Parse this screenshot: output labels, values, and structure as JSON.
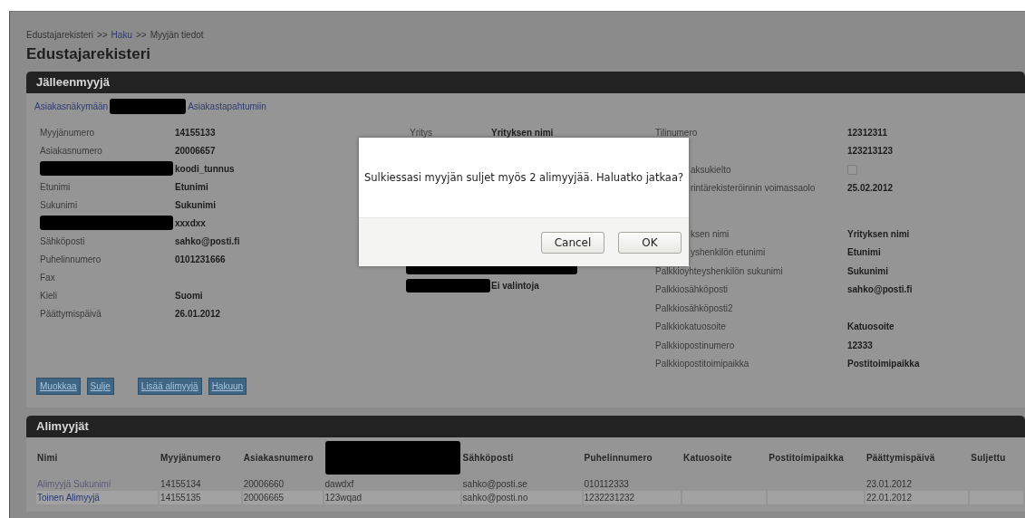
{
  "breadcrumb": [
    {
      "label": "Edustajarekisteri",
      "link": false
    },
    {
      "label": "Haku",
      "link": true
    },
    {
      "label": "Myyjän tiedot",
      "link": false
    }
  ],
  "breadcrumb_separator": ">>",
  "title": "Edustajarekisteri",
  "reseller": {
    "heading": "Jälleenmyyjä",
    "links": [
      {
        "kind": "link",
        "label": "Asiakasnäkymään"
      },
      {
        "kind": "redacted"
      },
      {
        "kind": "link",
        "label": "Asiakastapahtumiin"
      }
    ],
    "columns": [
      {
        "groups": [
          [
            {
              "kind": "field",
              "label": "Myyjänumero",
              "value": "14155133"
            },
            {
              "kind": "field",
              "label": "Asiakasnumero",
              "value": "20006657"
            },
            {
              "kind": "redacted",
              "value": "koodi_tunnus"
            },
            {
              "kind": "field",
              "label": "Etunimi",
              "value": "Etunimi"
            },
            {
              "kind": "field",
              "label": "Sukunimi",
              "value": "Sukunimi"
            },
            {
              "kind": "redacted",
              "value": "xxxdxx"
            },
            {
              "kind": "field",
              "label": "Sähköposti",
              "value": "sahko@posti.fi"
            },
            {
              "kind": "field",
              "label": "Puhelinnumero",
              "value": "0101231666"
            },
            {
              "kind": "field",
              "label": "Fax"
            },
            {
              "kind": "field",
              "label": "Kieli",
              "value": "Suomi"
            },
            {
              "kind": "field",
              "label": "Päättymispäivä",
              "value": "26.01.2012"
            }
          ]
        ]
      },
      {
        "groups": [
          [
            {
              "kind": "field",
              "label": "Yritys",
              "value": "Yrityksen nimi"
            }
          ],
          [
            {
              "kind": "blackout"
            },
            {
              "kind": "redacted",
              "value": "Ei valintoja"
            }
          ]
        ]
      },
      {
        "groups": [
          [
            {
              "kind": "field",
              "label": "Tilinumero",
              "value": "12312311"
            },
            {
              "kind": "value_only",
              "value": "123213123"
            },
            {
              "kind": "checkbox",
              "label": "aksukielto",
              "cut": true,
              "checked": false
            },
            {
              "kind": "field",
              "label": "rintärekisteröinnin voimassaolo",
              "cut": true,
              "value": "25.02.2012"
            }
          ],
          [
            {
              "kind": "field",
              "label": "ksen nimi",
              "cut": true,
              "value": "Yrityksen nimi"
            },
            {
              "kind": "field",
              "label": "yshenkilön etunimi",
              "cut": true,
              "value": "Etunimi"
            },
            {
              "kind": "field",
              "label": "Palkkioyhteyshenkilön sukunimi",
              "value": "Sukunimi"
            },
            {
              "kind": "field",
              "label": "Palkkiosähköposti",
              "value": "sahko@posti.fi"
            },
            {
              "kind": "field",
              "label": "Palkkiosähköposti2"
            },
            {
              "kind": "field",
              "label": "Palkkiokatuosoite",
              "value": "Katuosoite"
            },
            {
              "kind": "field",
              "label": "Palkkiopostinumero",
              "value": "12333"
            },
            {
              "kind": "field",
              "label": "Palkkiopostitoimipaikka",
              "value": "Postitoimipaikka"
            }
          ]
        ]
      }
    ],
    "button_groups": [
      [
        "Muokkaa",
        "Sulje"
      ],
      [
        "Lisää alimyyjä",
        "Hakuun"
      ]
    ]
  },
  "subsellers": {
    "heading": "Alimyyjät",
    "columns": [
      {
        "kind": "text",
        "label": "Nimi"
      },
      {
        "kind": "text",
        "label": "Myyjänumero"
      },
      {
        "kind": "text",
        "label": "Asiakasnumero"
      },
      {
        "kind": "redacted"
      },
      {
        "kind": "text",
        "label": "Sähköposti"
      },
      {
        "kind": "text",
        "label": "Puhelinnumero"
      },
      {
        "kind": "text",
        "label": "Katuosoite"
      },
      {
        "kind": "text",
        "label": "Postitoimipaikka"
      },
      {
        "kind": "text",
        "label": "Päättymispäivä"
      },
      {
        "kind": "text",
        "label": "Suljettu"
      }
    ],
    "rows": [
      {
        "visited": true,
        "selected": false,
        "cells": [
          "Alimyyjä Sukunimi",
          "14155134",
          "20006660",
          "dawdxf",
          "sahko@posti.se",
          "010112333",
          null,
          null,
          "23.01.2012",
          null
        ]
      },
      {
        "visited": false,
        "selected": true,
        "cells": [
          "Toinen Alimyyjä",
          "14155135",
          "20006665",
          "123wqad",
          "sahko@posti.no",
          "1232231232",
          null,
          null,
          "22.01.2012",
          null
        ]
      }
    ]
  },
  "dialog": {
    "message": "Sulkiessasi myyjän suljet myös 2 alimyyjää. Haluatko jatkaa?",
    "buttons": [
      "Cancel",
      "OK"
    ]
  }
}
